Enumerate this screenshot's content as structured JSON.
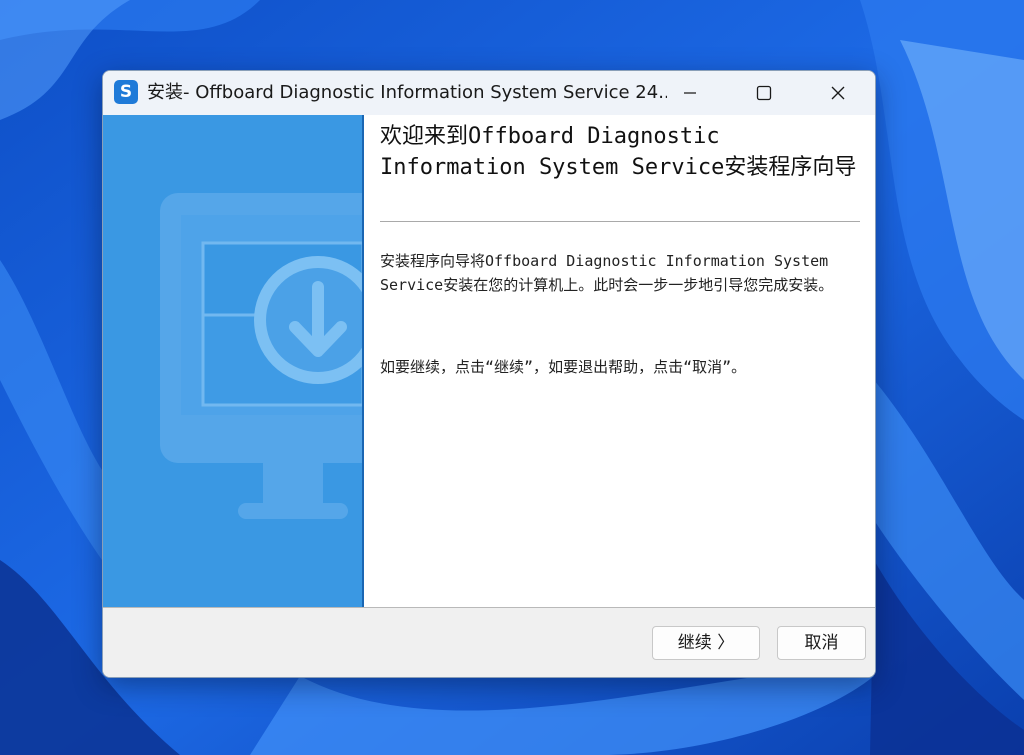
{
  "window": {
    "title": "安装- Offboard Diagnostic Information System Service 24....",
    "app_icon_letter": "S",
    "app_icon": "installer-app-icon",
    "controls": [
      "minimize-icon",
      "maximize-icon",
      "close-icon"
    ]
  },
  "side_panel": {
    "illustration": "monitor-download-icon",
    "color": "#3a98e3"
  },
  "content": {
    "heading": "欢迎来到Offboard Diagnostic Information System Service安装程序向导",
    "paragraph1": "安装程序向导将Offboard Diagnostic Information System Service安装在您的计算机上。此时会一步一步地引导您完成安装。",
    "paragraph2": "如要继续，点击“继续”，如要退出帮助，点击“取消”。"
  },
  "footer": {
    "next_label": "继续 〉",
    "cancel_label": "取消"
  },
  "colors": {
    "accent": "#1f7ad8",
    "desktop": "#1a5fd6"
  }
}
